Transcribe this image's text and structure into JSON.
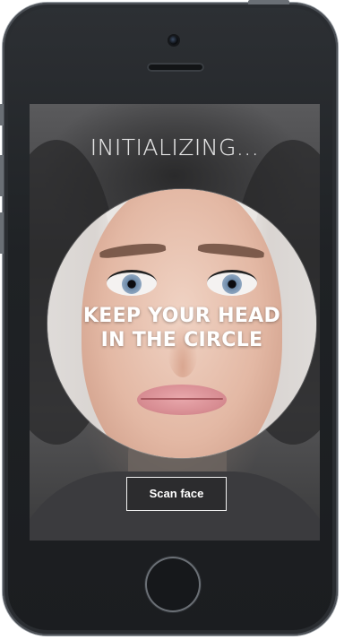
{
  "app": {
    "status_title": "INITIALIZING...",
    "instruction_line1": "KEEP YOUR HEAD",
    "instruction_line2": "IN THE CIRCLE",
    "scan_button_label": "Scan face"
  },
  "icons": {
    "camera": "front-camera-icon",
    "speaker": "earpiece-speaker-icon",
    "home": "home-button-icon"
  },
  "colors": {
    "device_body": "#1f2225",
    "overlay_text": "#ffffff",
    "button_border": "#f2f2f2"
  }
}
